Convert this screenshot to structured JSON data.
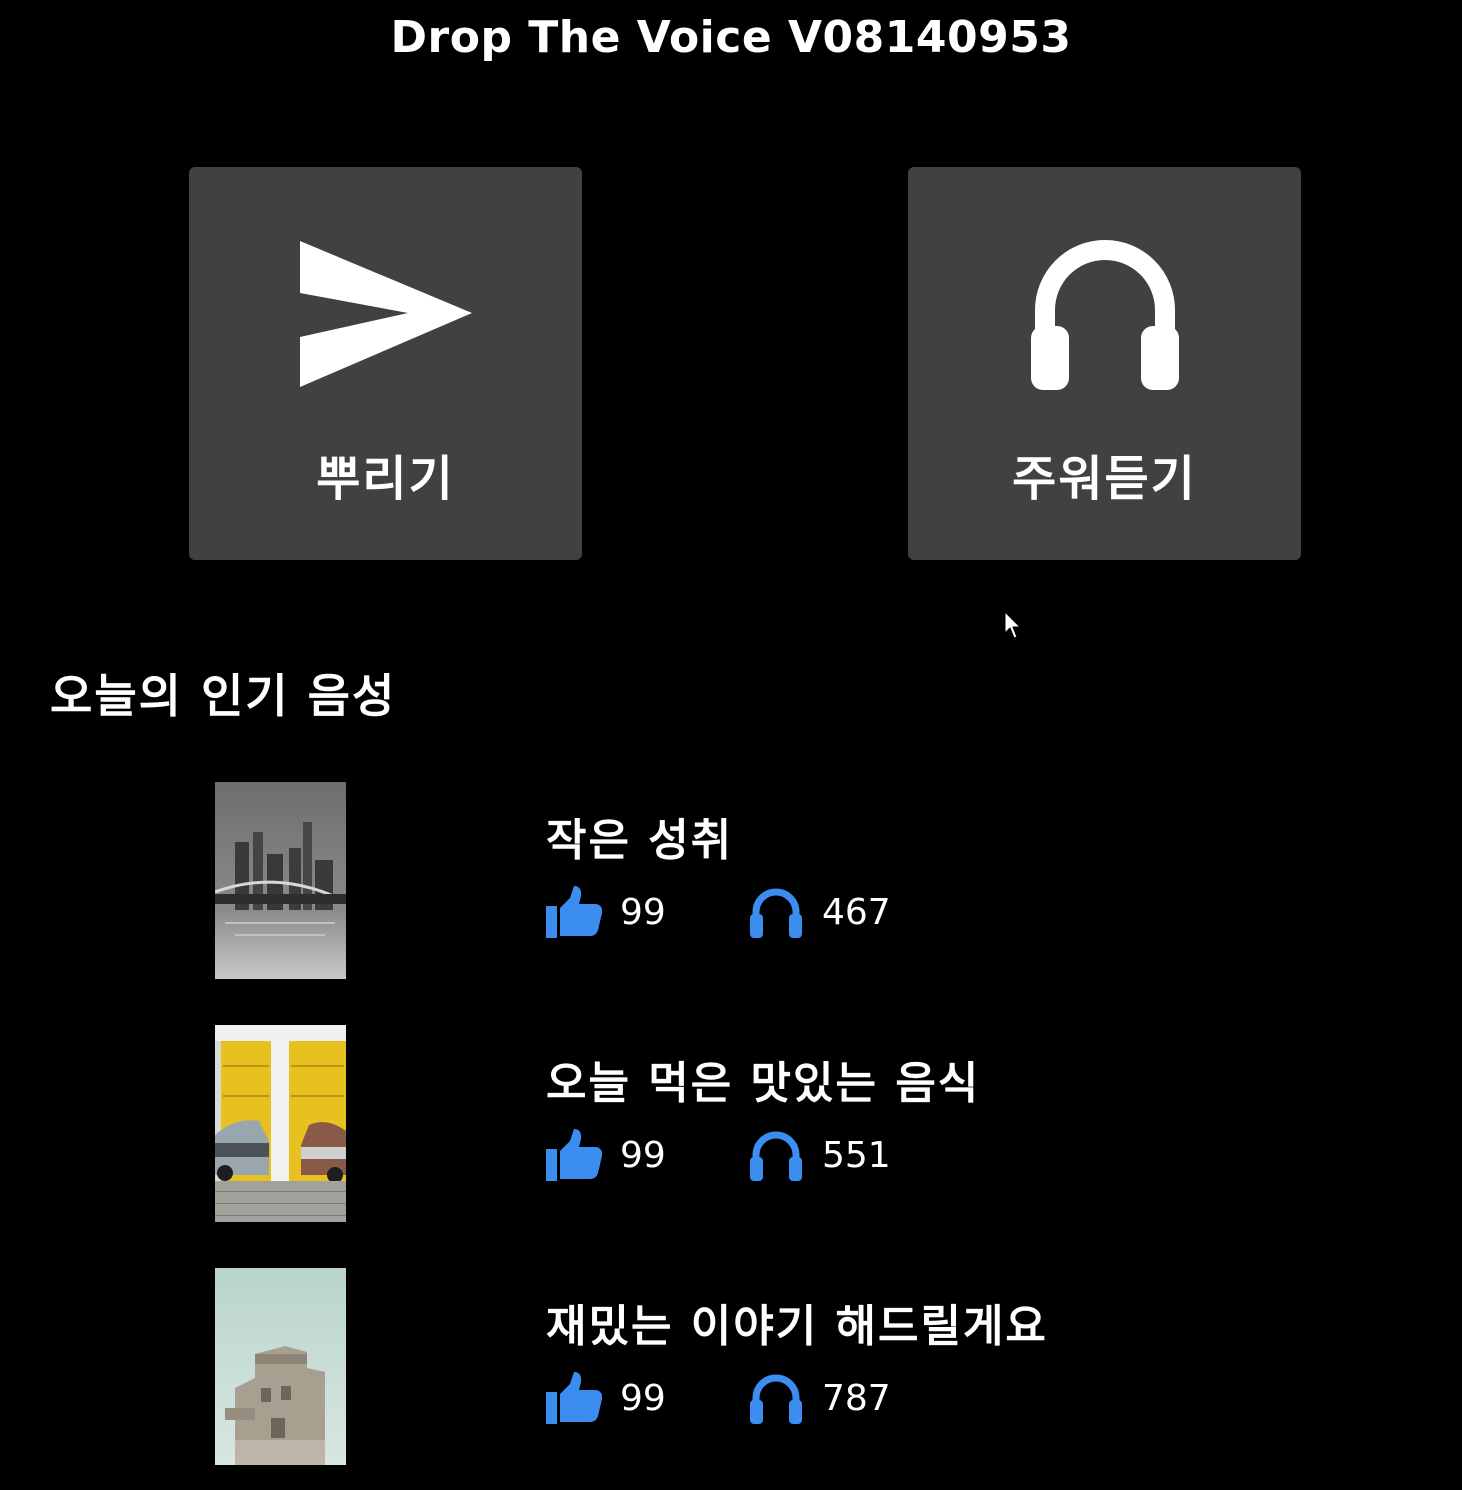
{
  "app": {
    "title": "Drop The Voice V08140953"
  },
  "actions": {
    "drop": {
      "label": "뿌리기",
      "icon": "send-icon"
    },
    "listen": {
      "label": "주워듣기",
      "icon": "headphones-icon"
    }
  },
  "popular": {
    "heading": "오늘의 인기 음성",
    "items": [
      {
        "title": "작은 성취",
        "likes": "99",
        "listens": "467",
        "thumbnail": "city-skyline-night"
      },
      {
        "title": "오늘 먹은 맛있는 음식",
        "likes": "99",
        "listens": "551",
        "thumbnail": "vintage-cars-yellow-garage"
      },
      {
        "title": "재밌는 이야기 해드릴게요",
        "likes": "99",
        "listens": "787",
        "thumbnail": "stone-tower-sky"
      }
    ]
  },
  "colors": {
    "background": "#000000",
    "tile": "#414141",
    "accent": "#3b8ef0",
    "text": "#ffffff"
  }
}
